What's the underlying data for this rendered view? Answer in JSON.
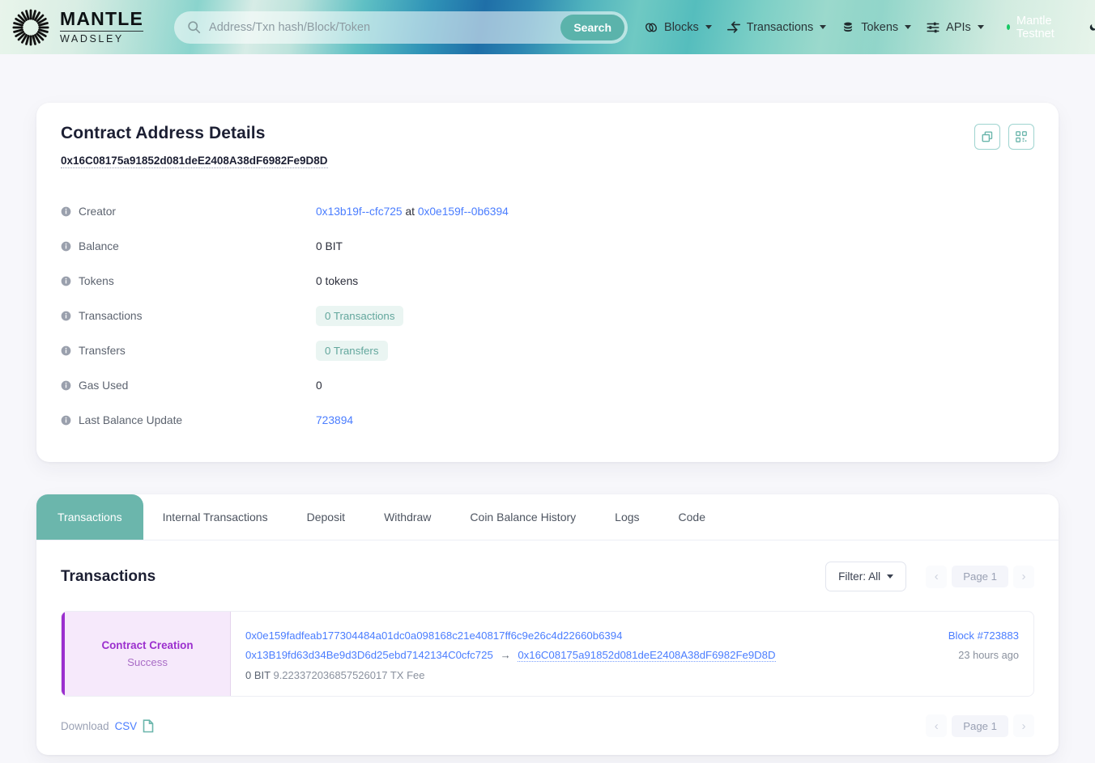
{
  "header": {
    "logo_icon": "mantle-sunburst-logo",
    "brand_main": "MANTLE",
    "brand_sub": "WADSLEY",
    "search": {
      "icon": "search-icon",
      "placeholder": "Address/Txn hash/Block/Token",
      "value": "",
      "button_label": "Search"
    },
    "nav": [
      {
        "label": "Blocks",
        "icon": "blocks-chain-icon",
        "has_caret": true
      },
      {
        "label": "Transactions",
        "icon": "transactions-arrows-icon",
        "has_caret": true
      },
      {
        "label": "Tokens",
        "icon": "tokens-coins-icon",
        "has_caret": true
      },
      {
        "label": "APIs",
        "icon": "apis-sliders-icon",
        "has_caret": true
      }
    ],
    "network": {
      "label": "Mantle Testnet",
      "dot_color": "#17c964"
    },
    "theme_toggle_icon": "moon-icon"
  },
  "details": {
    "title": "Contract Address Details",
    "address": "0x16C08175a91852d081deE2408A38dF6982Fe9D8D",
    "actions": [
      {
        "name": "copy-address-button",
        "icon": "copy-icon"
      },
      {
        "name": "qr-code-button",
        "icon": "qr-code-icon"
      }
    ],
    "rows": {
      "creator_label": "Creator",
      "creator_addr": "0x13b19f--cfc725",
      "creator_at": "at",
      "creator_txn": "0x0e159f--0b6394",
      "balance_label": "Balance",
      "balance_value": "0 BIT",
      "tokens_label": "Tokens",
      "tokens_value": "0 tokens",
      "transactions_label": "Transactions",
      "transactions_value": "0 Transactions",
      "transfers_label": "Transfers",
      "transfers_value": "0 Transfers",
      "gas_used_label": "Gas Used",
      "gas_used_value": "0",
      "last_balance_label": "Last Balance Update",
      "last_balance_value": "723894"
    }
  },
  "tabs": [
    {
      "label": "Transactions",
      "active": true
    },
    {
      "label": "Internal Transactions",
      "active": false
    },
    {
      "label": "Deposit",
      "active": false
    },
    {
      "label": "Withdraw",
      "active": false
    },
    {
      "label": "Coin Balance History",
      "active": false
    },
    {
      "label": "Logs",
      "active": false
    },
    {
      "label": "Code",
      "active": false
    }
  ],
  "transactions_panel": {
    "title": "Transactions",
    "filter_label": "Filter: All",
    "pager_top": {
      "prev": "‹",
      "page": "Page 1",
      "next": "›"
    },
    "pager_bottom": {
      "prev": "‹",
      "page": "Page 1",
      "next": "›"
    },
    "download": {
      "prefix": "Download",
      "link": "CSV",
      "icon": "file-csv-icon"
    },
    "rows": [
      {
        "type": "Contract Creation",
        "status": "Success",
        "hash": "0x0e159fadfeab177304484a01dc0a098168c21e40817ff6c9e26c4d22660b6394",
        "from": "0x13B19fd63d34Be9d3D6d25ebd7142134C0cfc725",
        "arrow": "→",
        "to": "0x16C08175a91852d081deE2408A38dF6982Fe9D8D",
        "value": "0 BIT",
        "fee": "9.223372036857526017",
        "fee_suffix": "TX Fee",
        "block": "Block #723883",
        "age": "23 hours ago"
      }
    ]
  },
  "colors": {
    "accent_teal": "#6bb6ac",
    "link_blue": "#4a7dff",
    "purple": "#9b2fce",
    "pill_bg": "#eaf5f2",
    "page_bg": "#f7f7fb"
  }
}
